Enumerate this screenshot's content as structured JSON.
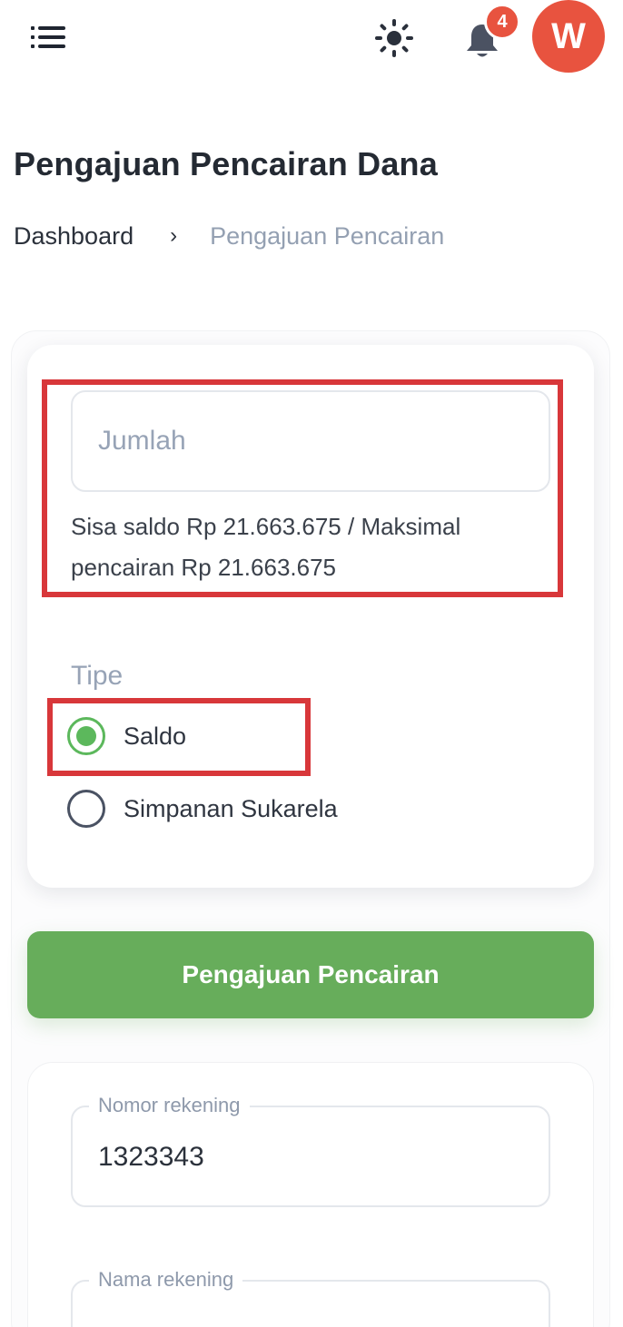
{
  "header": {
    "menu_icon": "hamburger-menu-icon",
    "theme_icon": "sun-icon",
    "notification_icon": "bell-icon",
    "notification_count": "4",
    "avatar_initial": "W",
    "accent_color": "#e8533f"
  },
  "page": {
    "title": "Pengajuan Pencairan Dana",
    "breadcrumb": {
      "home": "Dashboard",
      "separator": "›",
      "current": "Pengajuan Pencairan"
    }
  },
  "form": {
    "amount_placeholder": "Jumlah",
    "amount_value": "",
    "balance_note": "Sisa saldo Rp 21.663.675 / Maksimal pencairan Rp 21.663.675",
    "type_label": "Tipe",
    "type_options": [
      {
        "label": "Saldo",
        "selected": true
      },
      {
        "label": "Simpanan Sukarela",
        "selected": false
      }
    ],
    "submit_label": "Pengajuan Pencairan",
    "submit_color": "#67ad5b",
    "highlight_color": "#d8373a"
  },
  "bank": {
    "account_number_label": "Nomor rekening",
    "account_number_value": "1323343",
    "account_name_label": "Nama rekening"
  }
}
